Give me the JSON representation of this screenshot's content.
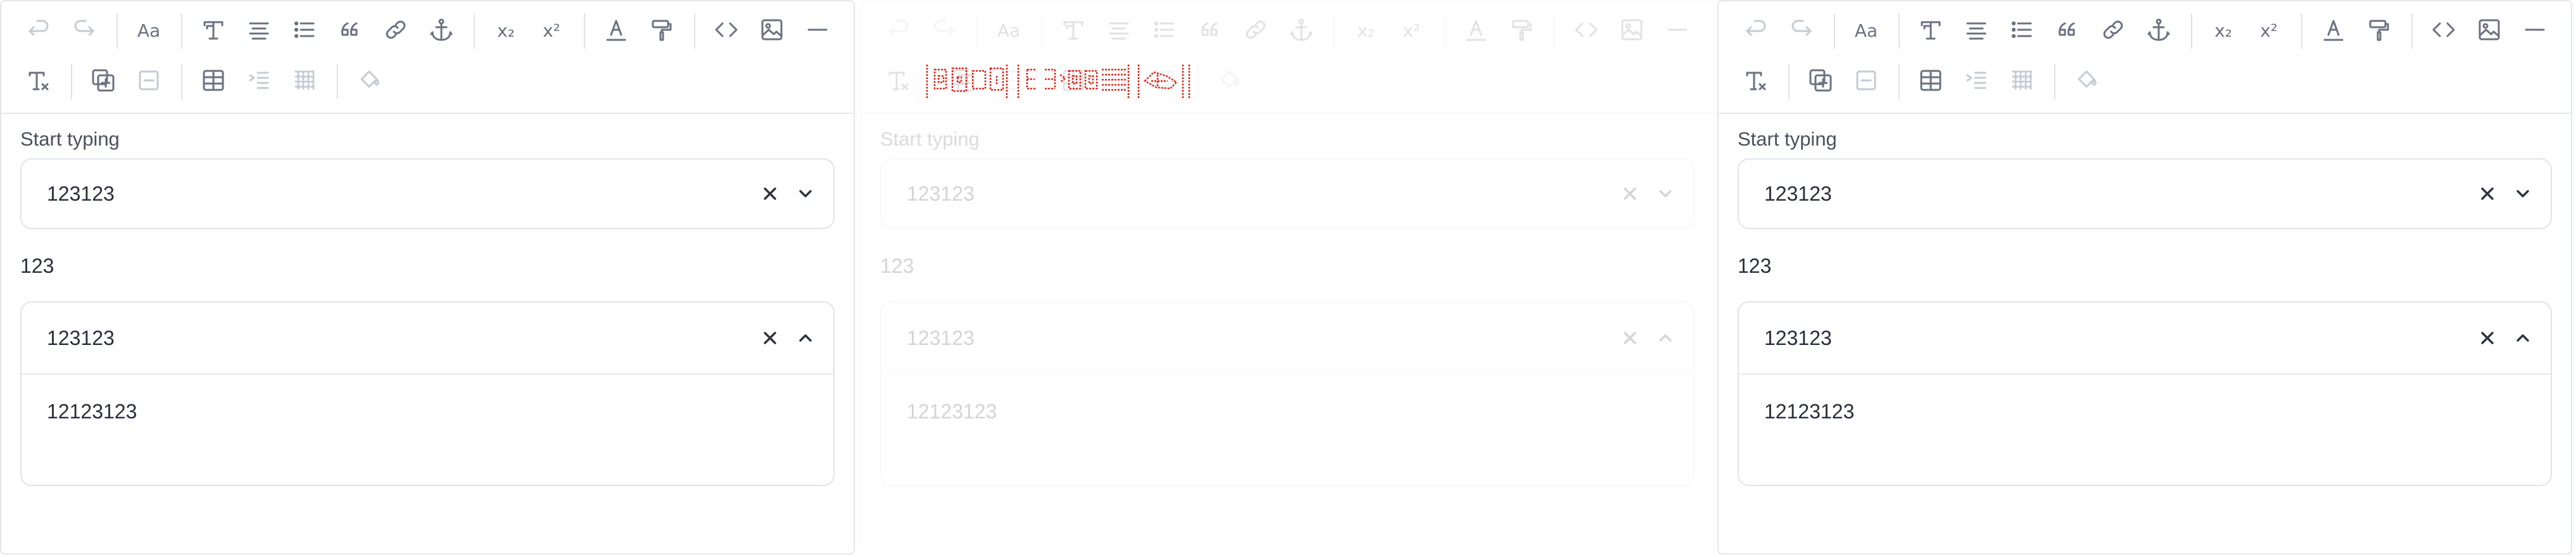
{
  "toolbar": {
    "row1": [
      {
        "icon": "undo-icon",
        "disabled": true
      },
      {
        "icon": "redo-icon",
        "disabled": true
      },
      {
        "sep": true
      },
      {
        "icon": "font-size-icon",
        "text": "Aa"
      },
      {
        "sep": true
      },
      {
        "icon": "text-style-icon"
      },
      {
        "icon": "align-icon"
      },
      {
        "icon": "bullet-list-icon"
      },
      {
        "icon": "quote-icon"
      },
      {
        "icon": "link-icon"
      },
      {
        "icon": "anchor-icon"
      },
      {
        "sep": true
      },
      {
        "icon": "subscript-icon",
        "text": "x₂"
      },
      {
        "icon": "superscript-icon",
        "text": "x²"
      },
      {
        "sep": true
      },
      {
        "icon": "text-color-icon"
      },
      {
        "icon": "paint-roller-icon"
      },
      {
        "sep": true
      },
      {
        "icon": "code-icon"
      },
      {
        "icon": "image-icon"
      },
      {
        "icon": "horizontal-rule-icon"
      }
    ],
    "row2": [
      {
        "icon": "clear-format-icon"
      },
      {
        "sep": true
      },
      {
        "icon": "add-block-icon"
      },
      {
        "icon": "remove-block-icon",
        "disabled": true
      },
      {
        "sep": true
      },
      {
        "icon": "table-icon"
      },
      {
        "icon": "indent-icon",
        "disabled": true
      },
      {
        "icon": "table-grid-icon",
        "disabled": true
      },
      {
        "sep": true
      },
      {
        "icon": "fill-color-icon",
        "disabled": true
      }
    ]
  },
  "panels": [
    {
      "label": "Start typing",
      "select1": {
        "value": "123123"
      },
      "static_text": "123",
      "select2": {
        "value": "123123",
        "option": "12123123"
      }
    },
    {
      "label": "Start typing",
      "select1": {
        "value": "123123"
      },
      "static_text": "123",
      "select2": {
        "value": "123123",
        "option": "12123123"
      }
    },
    {
      "label": "Start typing",
      "select1": {
        "value": "123123"
      },
      "static_text": "123",
      "select2": {
        "value": "123123",
        "option": "12123123"
      }
    }
  ],
  "colors": {
    "icon": "#6c7180",
    "icon_disabled": "#c6cad3",
    "border": "#e1e3ea",
    "glitch": "#e0261a"
  }
}
